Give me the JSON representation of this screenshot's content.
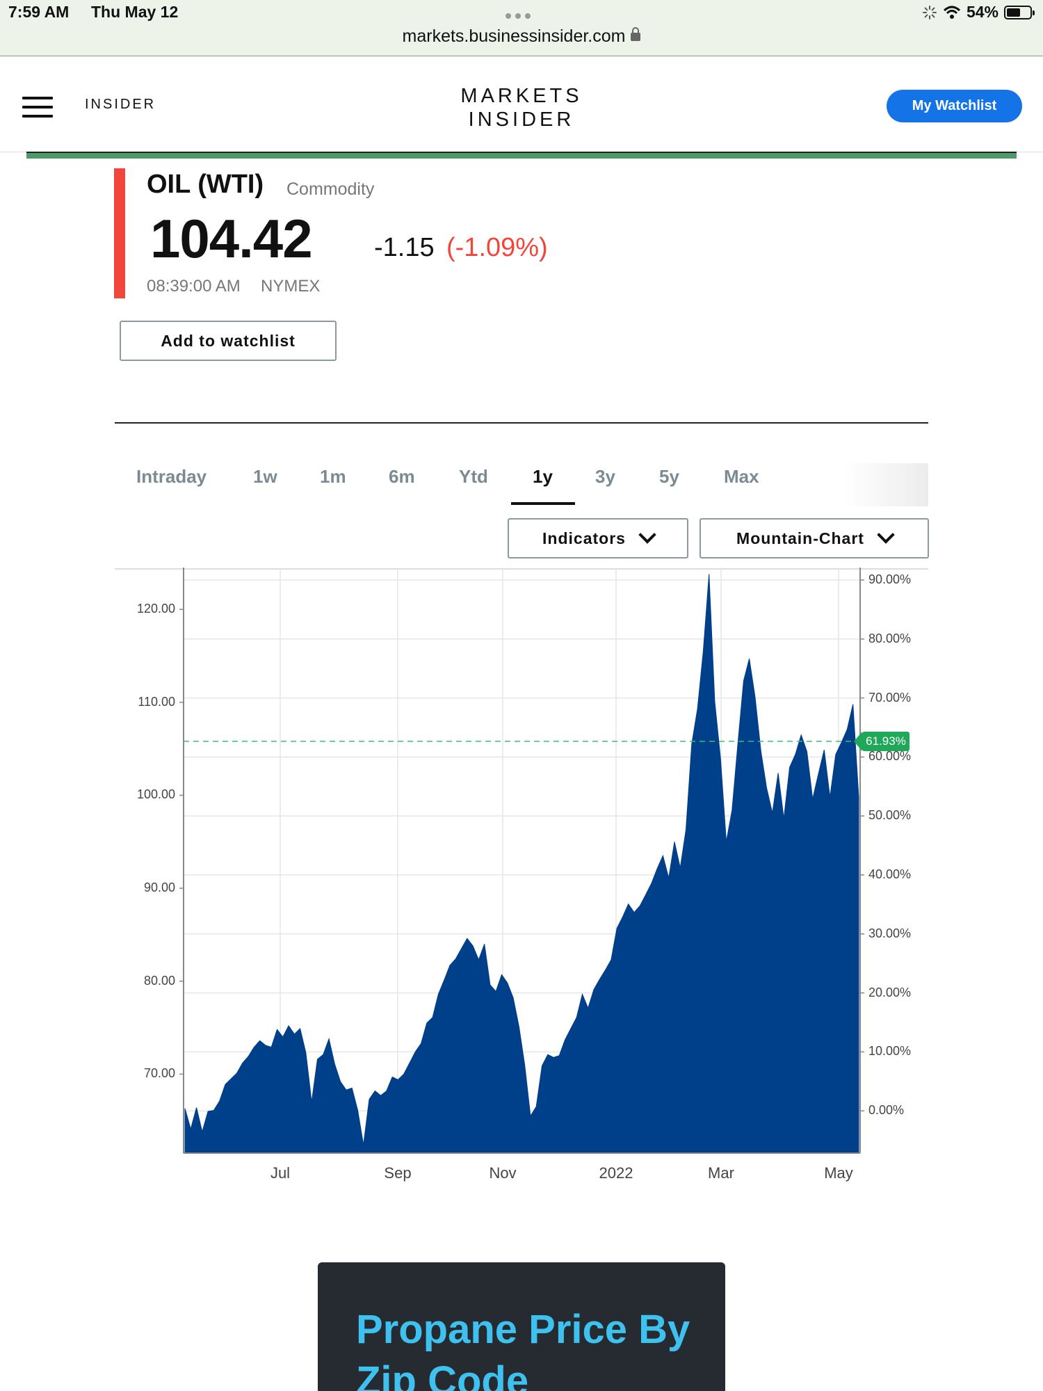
{
  "status_bar": {
    "time": "7:59 AM",
    "date": "Thu May 12",
    "url": "markets.businessinsider.com",
    "battery": "54%"
  },
  "header": {
    "brand": "INSIDER",
    "logo_line1": "MARKETS",
    "logo_line2": "INSIDER",
    "watchlist_button": "My Watchlist",
    "accent_color": "#1573e8"
  },
  "quote": {
    "name": "OIL (WTI)",
    "type": "Commodity",
    "price": "104.42",
    "change": "-1.15",
    "change_pct": "(-1.09%)",
    "time": "08:39:00 AM",
    "exchange": "NYMEX",
    "add_to_watchlist": "Add to watchlist",
    "down_color": "#f0473a"
  },
  "tabs": {
    "items": [
      "Intraday",
      "1w",
      "1m",
      "6m",
      "Ytd",
      "1y",
      "3y",
      "5y",
      "Max"
    ],
    "active": "1y"
  },
  "controls": {
    "indicators": "Indicators",
    "chart_type": "Mountain-Chart"
  },
  "chart_data": {
    "type": "area",
    "color": "#003f8a",
    "x_ticks": [
      "Jul",
      "Sep",
      "Nov",
      "2022",
      "Mar",
      "May"
    ],
    "y_ticks_left": [
      "120.00",
      "110.00",
      "100.00",
      "90.00",
      "80.00",
      "70.00"
    ],
    "y_ticks_right": [
      "90.00%",
      "80.00%",
      "70.00%",
      "60.00%",
      "50.00%",
      "40.00%",
      "30.00%",
      "20.00%",
      "10.00%",
      "0.00%"
    ],
    "ylim": [
      61.5,
      124.5
    ],
    "reference_label": "61.93%",
    "reference_value": 105.8,
    "grid": true,
    "values": [
      66.3,
      64.1,
      66.4,
      63.8,
      66.0,
      66.1,
      67.1,
      68.9,
      69.5,
      70.1,
      71.2,
      71.9,
      72.9,
      73.6,
      73.1,
      72.9,
      74.8,
      74.0,
      75.2,
      74.3,
      74.9,
      72.3,
      67.0,
      71.6,
      72.1,
      73.8,
      71.1,
      69.2,
      68.3,
      68.5,
      66.1,
      62.4,
      67.3,
      68.2,
      67.7,
      68.2,
      69.7,
      69.4,
      70.0,
      71.2,
      72.4,
      73.3,
      75.5,
      76.1,
      78.6,
      80.1,
      81.7,
      82.4,
      83.5,
      84.6,
      83.8,
      82.3,
      84.0,
      79.6,
      78.9,
      80.7,
      79.8,
      78.2,
      75.1,
      71.0,
      65.5,
      66.5,
      70.9,
      72.1,
      71.8,
      72.0,
      73.7,
      74.9,
      76.1,
      78.6,
      77.1,
      79.1,
      80.2,
      81.2,
      82.3,
      85.7,
      86.9,
      88.3,
      87.4,
      88.1,
      89.3,
      90.5,
      92.1,
      93.5,
      91.1,
      95.0,
      92.2,
      96.3,
      105.5,
      109.3,
      115.5,
      123.8,
      110.1,
      104.0,
      95.0,
      98.4,
      105.5,
      112.3,
      114.7,
      110.6,
      104.8,
      100.8,
      98.1,
      102.4,
      97.5,
      103.0,
      104.4,
      106.5,
      104.7,
      99.6,
      102.3,
      104.9,
      99.8,
      104.4,
      105.7,
      107.1,
      109.8,
      99.8
    ]
  },
  "ad": {
    "title": "Propane Price By Zip Code"
  }
}
